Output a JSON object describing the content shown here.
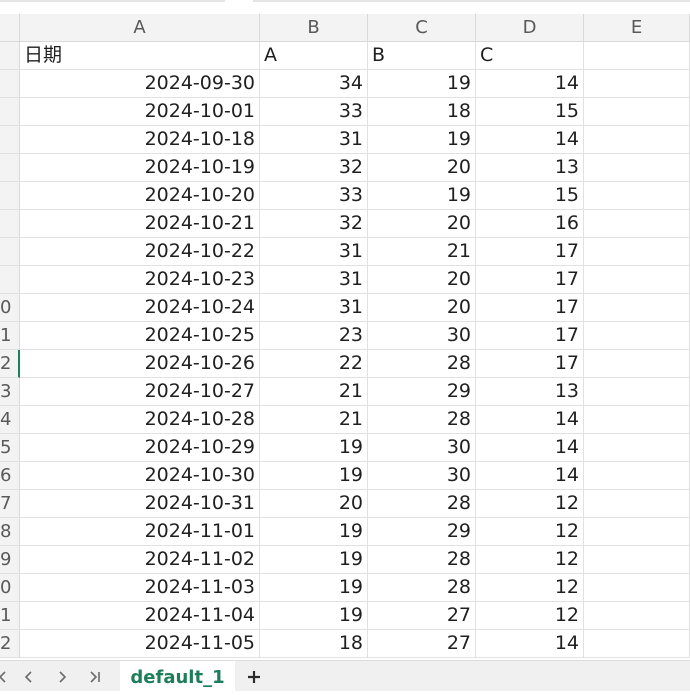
{
  "columns": [
    "A",
    "B",
    "C",
    "D",
    "E"
  ],
  "header_row": [
    "日期",
    "A",
    "B",
    "C",
    ""
  ],
  "row_numbers": [
    "",
    "",
    "",
    "",
    "",
    "",
    "",
    "",
    "",
    "0",
    "1",
    "2",
    "3",
    "4",
    "5",
    "6",
    "7",
    "8",
    "9",
    "0",
    "1",
    "2"
  ],
  "selected_row_index": 11,
  "rows": [
    [
      "2024-09-30",
      34,
      19,
      14
    ],
    [
      "2024-10-01",
      33,
      18,
      15
    ],
    [
      "2024-10-18",
      31,
      19,
      14
    ],
    [
      "2024-10-19",
      32,
      20,
      13
    ],
    [
      "2024-10-20",
      33,
      19,
      15
    ],
    [
      "2024-10-21",
      32,
      20,
      16
    ],
    [
      "2024-10-22",
      31,
      21,
      17
    ],
    [
      "2024-10-23",
      31,
      20,
      17
    ],
    [
      "2024-10-24",
      31,
      20,
      17
    ],
    [
      "2024-10-25",
      23,
      30,
      17
    ],
    [
      "2024-10-26",
      22,
      28,
      17
    ],
    [
      "2024-10-27",
      21,
      29,
      13
    ],
    [
      "2024-10-28",
      21,
      28,
      14
    ],
    [
      "2024-10-29",
      19,
      30,
      14
    ],
    [
      "2024-10-30",
      19,
      30,
      14
    ],
    [
      "2024-10-31",
      20,
      28,
      12
    ],
    [
      "2024-11-01",
      19,
      29,
      12
    ],
    [
      "2024-11-02",
      19,
      28,
      12
    ],
    [
      "2024-11-03",
      19,
      28,
      12
    ],
    [
      "2024-11-04",
      19,
      27,
      12
    ],
    [
      "2024-11-05",
      18,
      27,
      14
    ]
  ],
  "sheet_tabs": [
    {
      "label": "default_1",
      "active": true
    }
  ],
  "nav_icons": [
    "nav-first-icon",
    "nav-prev-icon",
    "nav-next-icon",
    "nav-last-icon"
  ],
  "add_sheet_icon": "plus-icon",
  "colors": {
    "accent": "#1e7d5a",
    "header_bg": "#f3f3f3",
    "grid": "#e1e1e1"
  }
}
